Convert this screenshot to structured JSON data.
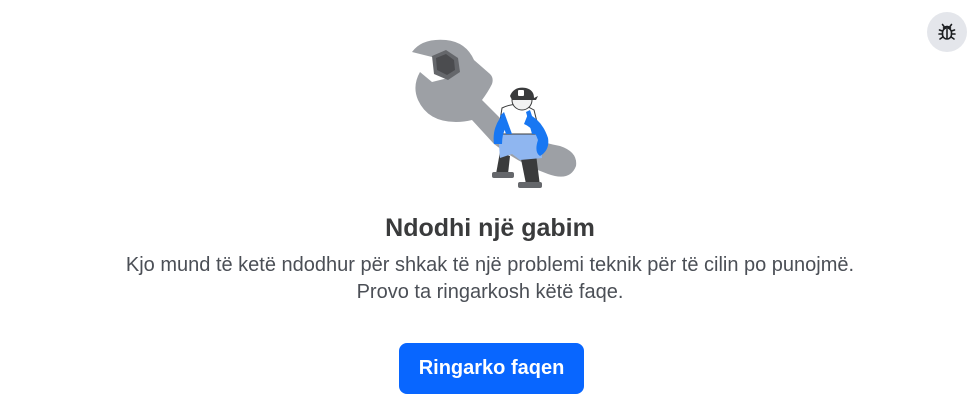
{
  "error": {
    "title": "Ndodhi një gabim",
    "message_line_1": "Kjo mund të ketë ndodhur për shkak të një problemi teknik për të cilin po punojmë.",
    "message_line_2": "Provo ta ringarkosh këtë faqe.",
    "illustration": "wrench-with-worker-illustration"
  },
  "actions": {
    "reload_label": "Ringarko faqen",
    "report_bug_icon": "bug-icon"
  },
  "colors": {
    "primary_button": "#0866ff",
    "bug_button_bg": "#e4e6eb",
    "title_text": "#3a3b3c",
    "body_text": "#4b4f56"
  }
}
